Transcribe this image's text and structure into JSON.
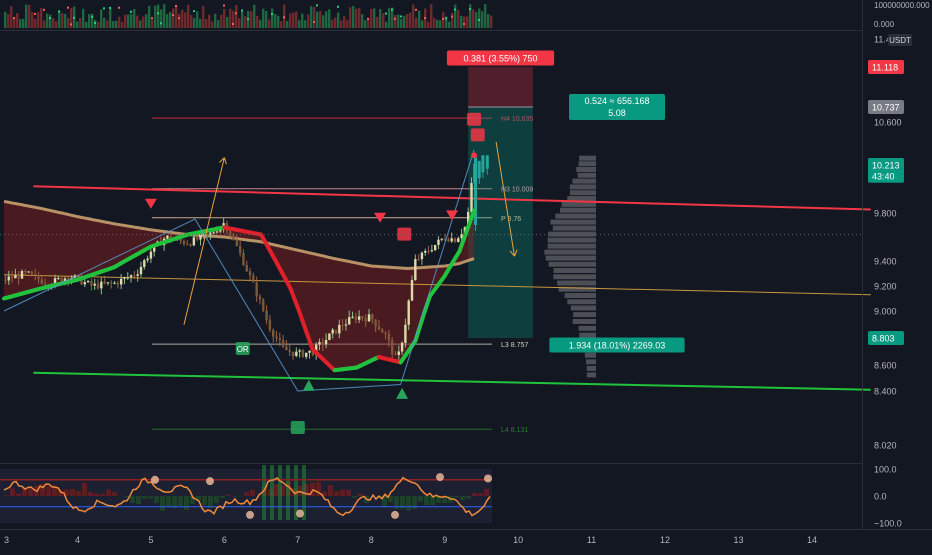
{
  "chart_data": {
    "type": "line",
    "title": "",
    "price_axis": {
      "ticks": [
        "11.400",
        "10.600",
        "9.800",
        "9.400",
        "9.200",
        "9.000",
        "8.600",
        "8.400",
        "8.020"
      ],
      "ylim": [
        7.9,
        11.45
      ],
      "quote_label": "USDT"
    },
    "volume_axis": {
      "ticks": [
        "100000000.000",
        "0.000"
      ]
    },
    "oscillator_axis": {
      "ticks": [
        "100.0",
        "0.0",
        "−100.0"
      ]
    },
    "time_axis": {
      "ticks": [
        "3",
        "4",
        "5",
        "6",
        "7",
        "8",
        "9",
        "10",
        "11",
        "12",
        "13",
        "14"
      ],
      "xlim": [
        3,
        14.8
      ]
    },
    "price_badges": [
      {
        "text": "11.118",
        "value": 11.118,
        "color": "#f23645",
        "text_color": "#ffffff"
      },
      {
        "text": "10.737",
        "value": 10.737,
        "color": "#787b86",
        "text_color": "#ffffff"
      },
      {
        "text": "10.213",
        "value": 10.213,
        "color": "#089981",
        "text_color": "#ffffff"
      },
      {
        "text": "43:40",
        "value": 10.12,
        "color": "#089981",
        "text_color": "#ffffff"
      },
      {
        "text": "8.803",
        "value": 8.803,
        "color": "#089981",
        "text_color": "#ffffff"
      }
    ],
    "pivot_levels": [
      {
        "label": "H4 10.635",
        "value": 10.635,
        "color": "#f23645"
      },
      {
        "label": "H3 10.009",
        "value": 10.009,
        "color": "#f7a1a8"
      },
      {
        "label": "P 9.76",
        "value": 9.76,
        "color": "#f7c9a8"
      },
      {
        "label": "L3 8.757",
        "value": 8.757,
        "color": "#d1d4c1"
      },
      {
        "label": "L4 8.131",
        "value": 8.131,
        "color": "#2e7d32"
      }
    ],
    "position_tool": {
      "entry": 10.737,
      "stop": 11.118,
      "target": 8.803,
      "x_range": [
        9.32,
        10.2
      ],
      "stop_label": "0.381 (3.55%) 750",
      "risk_reward_line1": "0.524 ≈ 656.168",
      "risk_reward_line2": "5.08",
      "target_label": "1.934 (18.01%) 2269.03",
      "colors": {
        "stop": "#f23645",
        "target": "#089981"
      }
    },
    "trendlines": [
      {
        "name": "resistance",
        "x": [
          3.4,
          14.8
        ],
        "y": [
          10.03,
          9.83
        ],
        "color": "#f23645"
      },
      {
        "name": "support",
        "x": [
          3.4,
          14.8
        ],
        "y": [
          8.54,
          8.41
        ],
        "color": "#22c33c"
      },
      {
        "name": "regression",
        "x": [
          3.0,
          14.8
        ],
        "y": [
          9.29,
          9.13
        ],
        "color": "#c8963c"
      }
    ],
    "moving_averages": [
      {
        "name": "slow-ma",
        "color": "#c8a06e",
        "x": [
          3,
          3.5,
          4,
          4.5,
          5,
          5.5,
          6,
          6.5,
          7,
          7.5,
          8,
          8.5,
          9,
          9.2,
          9.4
        ],
        "y": [
          9.9,
          9.84,
          9.77,
          9.71,
          9.66,
          9.62,
          9.6,
          9.56,
          9.49,
          9.42,
          9.36,
          9.34,
          9.36,
          9.38,
          9.42
        ]
      },
      {
        "name": "fast-ma",
        "x": [
          3,
          3.5,
          4,
          4.5,
          5,
          5.5,
          6,
          6.5,
          6.9,
          7.2,
          7.5,
          7.8,
          8.1,
          8.4,
          8.6,
          8.8,
          9.0,
          9.2,
          9.4
        ],
        "y": [
          9.1,
          9.18,
          9.25,
          9.35,
          9.52,
          9.62,
          9.68,
          9.62,
          9.18,
          8.72,
          8.56,
          8.58,
          8.66,
          8.62,
          8.78,
          9.12,
          9.28,
          9.48,
          9.82
        ],
        "colors": {
          "bull": "#22c33c",
          "bear": "#e0202a"
        }
      }
    ],
    "price_path": {
      "x": [
        3,
        3.3,
        3.6,
        3.9,
        4.2,
        4.5,
        4.8,
        5.0,
        5.2,
        5.5,
        5.8,
        6.0,
        6.2,
        6.4,
        6.6,
        6.8,
        7.0,
        7.2,
        7.4,
        7.6,
        7.8,
        8.0,
        8.2,
        8.35,
        8.45,
        8.6,
        8.8,
        9.0,
        9.15,
        9.3,
        9.4,
        9.45
      ],
      "y": [
        9.25,
        9.3,
        9.22,
        9.28,
        9.2,
        9.22,
        9.3,
        9.48,
        9.6,
        9.55,
        9.62,
        9.72,
        9.48,
        9.2,
        8.9,
        8.72,
        8.68,
        8.7,
        8.8,
        8.9,
        8.96,
        8.95,
        8.82,
        8.62,
        8.86,
        9.4,
        9.5,
        9.6,
        9.58,
        9.7,
        10.22,
        10.2
      ]
    },
    "zigzag": {
      "x": [
        3.0,
        5.6,
        7.0,
        8.4,
        9.4
      ],
      "y": [
        9.0,
        9.75,
        8.4,
        8.45,
        10.35
      ],
      "color": "#5b9bd5"
    },
    "forecast_arrows": [
      {
        "from": [
          5.45,
          8.9
        ],
        "to": [
          6.0,
          10.28
        ],
        "color": "#e8a33c"
      },
      {
        "from": [
          9.7,
          10.42
        ],
        "to": [
          9.95,
          9.44
        ],
        "color": "#e8a33c"
      }
    ],
    "markers": [
      {
        "kind": "triangle-down",
        "x": 5.0,
        "y": 9.88,
        "color": "#f23645"
      },
      {
        "kind": "triangle-down",
        "x": 8.12,
        "y": 9.76,
        "color": "#f23645"
      },
      {
        "kind": "triangle-down",
        "x": 9.1,
        "y": 9.78,
        "color": "#f23645"
      },
      {
        "kind": "triangle-up",
        "x": 7.15,
        "y": 8.44,
        "color": "#26a65b"
      },
      {
        "kind": "triangle-up",
        "x": 8.42,
        "y": 8.38,
        "color": "#26a65b"
      },
      {
        "kind": "badge",
        "x": 6.25,
        "y": 8.72,
        "text": "OR",
        "color": "#26a65b"
      },
      {
        "kind": "badge",
        "x": 7.0,
        "y": 8.14,
        "text": "",
        "color": "#26a65b"
      },
      {
        "kind": "badge",
        "x": 8.45,
        "y": 9.62,
        "text": "",
        "color": "#f23645"
      },
      {
        "kind": "badge",
        "x": 9.4,
        "y": 10.62,
        "text": "",
        "color": "#f23645"
      },
      {
        "kind": "badge",
        "x": 9.45,
        "y": 10.48,
        "text": "",
        "color": "#f23645"
      }
    ],
    "grid": false,
    "legend": "none"
  },
  "colors": {
    "background": "#131722",
    "axis_text": "#b2b5be",
    "pane_border": "#2a2e39",
    "bull": "#26a69a",
    "bear": "#ef5350"
  }
}
